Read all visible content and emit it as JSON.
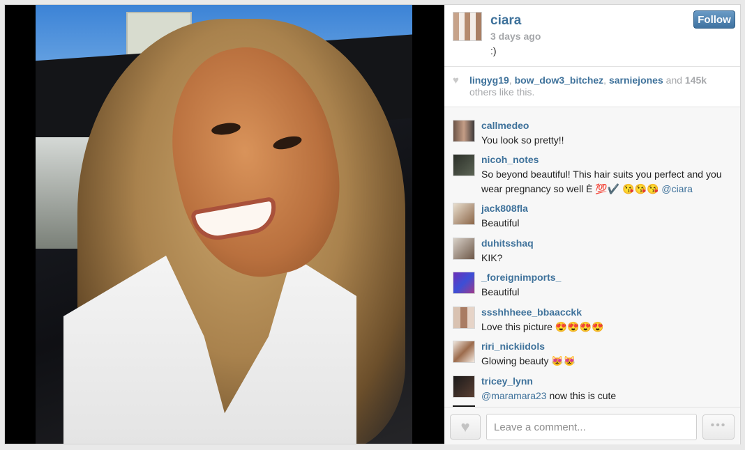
{
  "post": {
    "author": "ciara",
    "time_ago": "3 days ago",
    "caption": ":)",
    "follow_label": "Follow"
  },
  "likes": {
    "users": [
      "lingyg19",
      "bow_dow3_bitchez",
      "sarniejones"
    ],
    "sep1": ", ",
    "sep2": ", ",
    "and_text": " and ",
    "count": "145k",
    "others_text": " others like this."
  },
  "comments": [
    {
      "user": "callmedeo",
      "text": "You look so pretty!!"
    },
    {
      "user": "nicoh_notes",
      "text": "So beyond beautiful! This hair suits you perfect and you wear pregnancy so well È 💯✔️ 😘😘😘",
      "mention": "@ciara"
    },
    {
      "user": "jack808fla",
      "text": "Beautiful"
    },
    {
      "user": "duhitsshaq",
      "text": "KIK?"
    },
    {
      "user": "_foreignimports_",
      "text": "Beautiful"
    },
    {
      "user": "ssshhheee_bbaacckk",
      "text": "Love this picture 😍😍😍😍"
    },
    {
      "user": "riri_nickiidols",
      "text": "Glowing beauty 😻😻"
    },
    {
      "user": "tricey_lynn",
      "mention": "@maramara23",
      "text": " now this is cute"
    }
  ],
  "footer": {
    "comment_placeholder": "Leave a comment...",
    "more_label": "•••",
    "heart_icon": "heart-icon"
  },
  "colors": {
    "link_blue": "#3f729b",
    "muted_gray": "#a5a7aa",
    "follow_button": "#3f72a0"
  }
}
